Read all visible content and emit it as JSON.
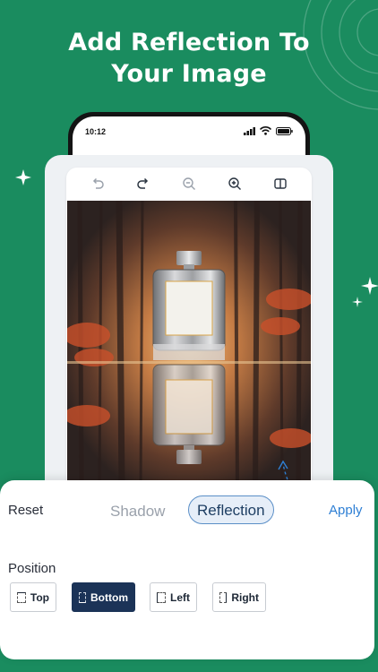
{
  "headline": {
    "line1": "Add Reflection To",
    "line2": "Your Image"
  },
  "phone": {
    "time": "10:12"
  },
  "toolbar": {
    "icons": [
      "undo-icon",
      "redo-icon",
      "zoom-out-icon",
      "zoom-in-icon",
      "compare-icon"
    ]
  },
  "panel": {
    "reset_label": "Reset",
    "tabs": {
      "shadow": "Shadow",
      "reflection": "Reflection"
    },
    "apply_label": "Apply",
    "position_label": "Position",
    "positions": {
      "top": "Top",
      "bottom": "Bottom",
      "left": "Left",
      "right": "Right"
    },
    "selected_position": "Bottom",
    "selected_tab": "Reflection"
  },
  "colors": {
    "background": "#1a8c5f",
    "accent_blue": "#2e7fd4",
    "selected_dark": "#1b3357"
  }
}
